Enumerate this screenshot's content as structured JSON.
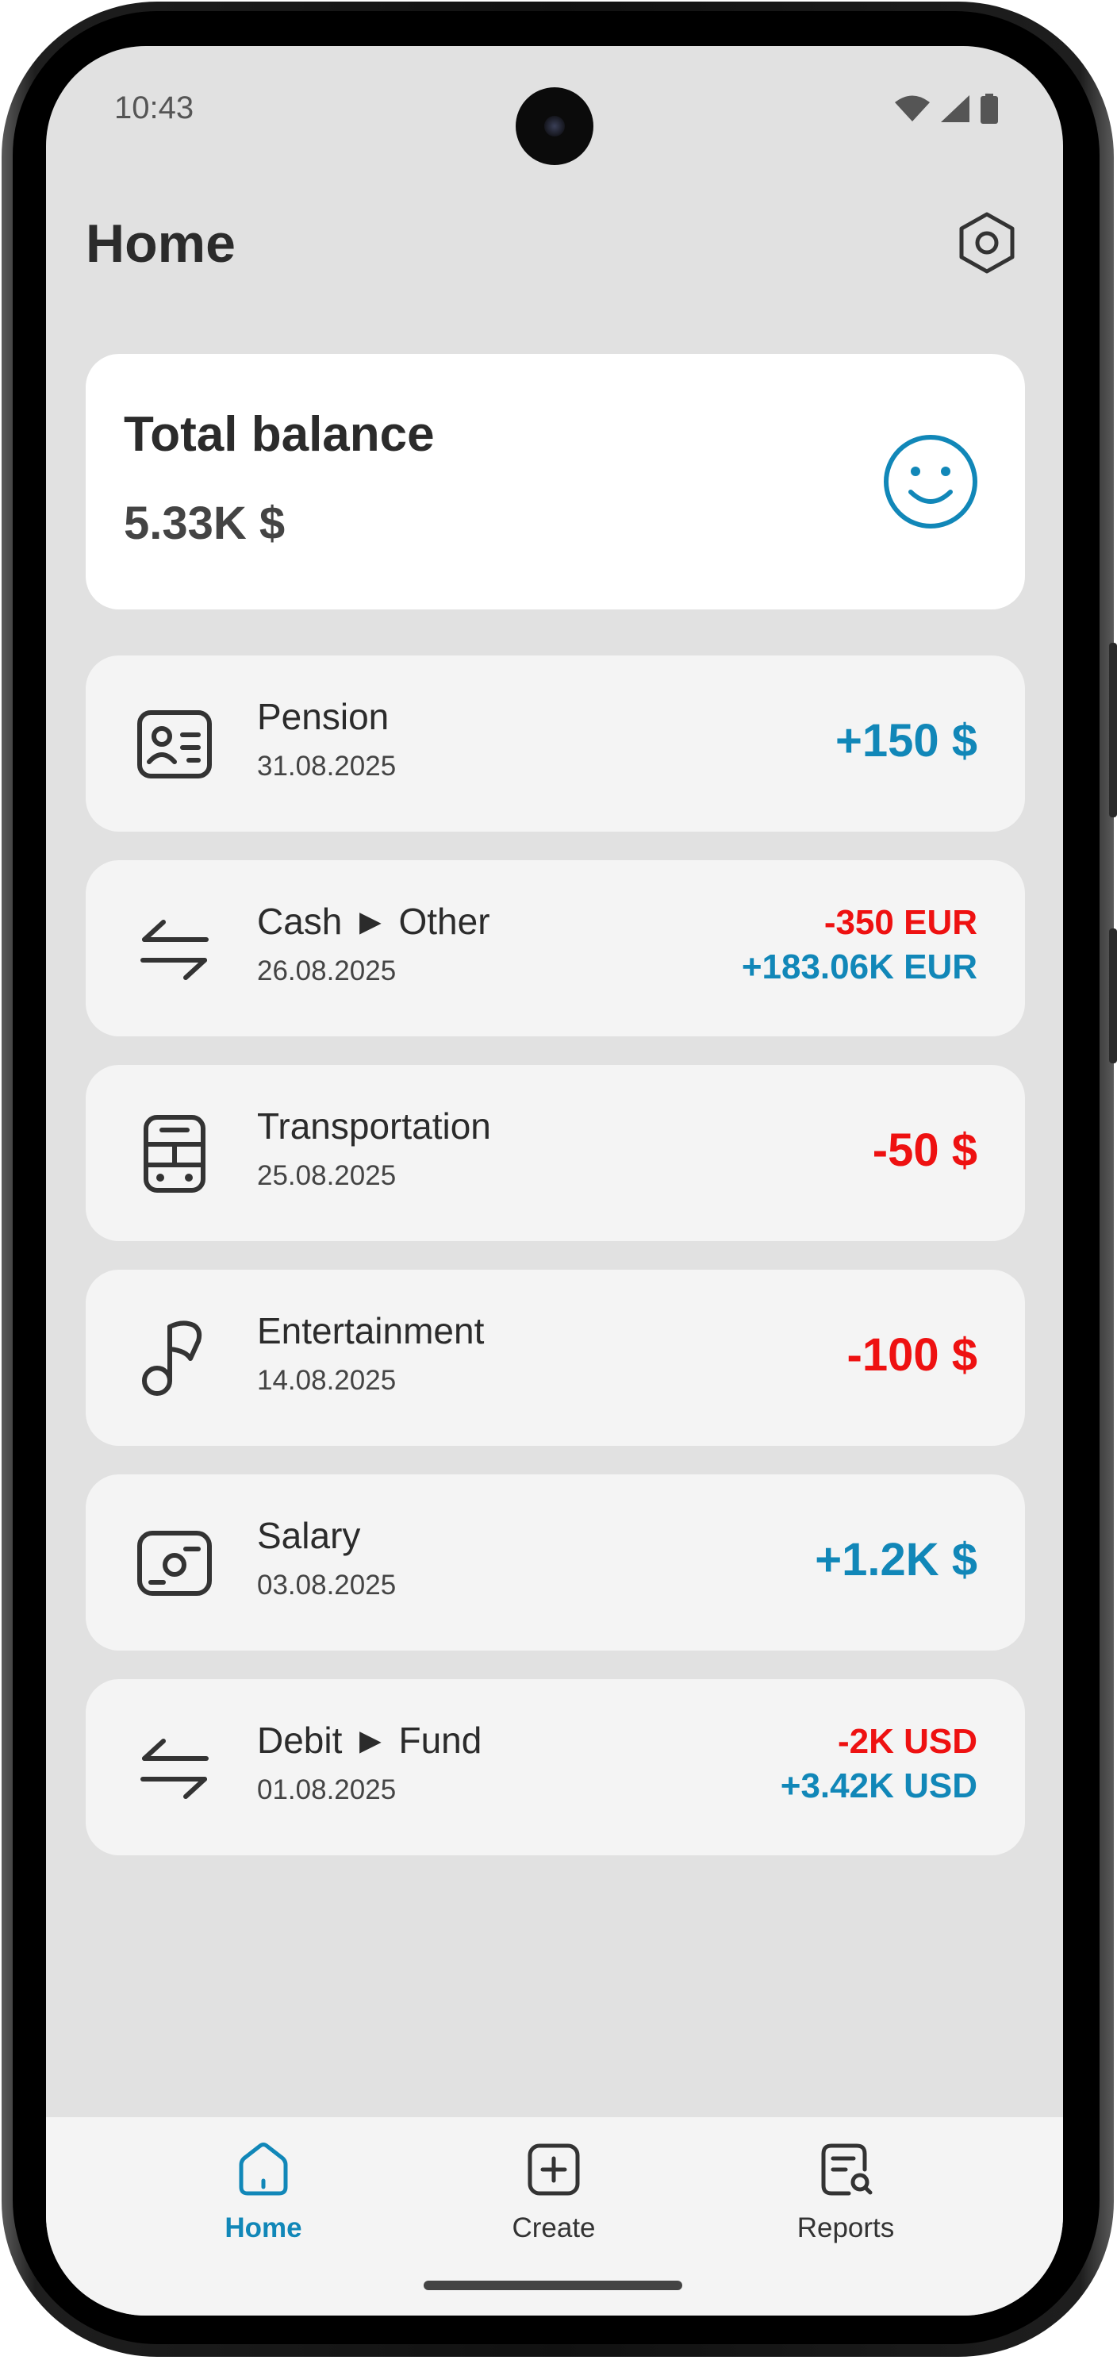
{
  "status_bar": {
    "time": "10:43",
    "icons": [
      "wifi-icon",
      "cellular-signal-icon",
      "battery-icon"
    ]
  },
  "header": {
    "title": "Home",
    "settings_icon": "settings-hexagon-icon"
  },
  "balance": {
    "title": "Total balance",
    "value": "5.33K $",
    "mood_icon": "smiley-face-icon"
  },
  "transactions": [
    {
      "icon": "id-card-icon",
      "title": "Pension",
      "date": "31.08.2025",
      "amount": "+150 $"
    },
    {
      "icon": "transfer-arrows-icon",
      "title": "Cash ► Other",
      "date": "26.08.2025",
      "amount_out": "-350 EUR",
      "amount_in": "+183.06K EUR"
    },
    {
      "icon": "bus-icon",
      "title": "Transportation",
      "date": "25.08.2025",
      "amount": "-50 $"
    },
    {
      "icon": "music-note-icon",
      "title": "Entertainment",
      "date": "14.08.2025",
      "amount": "-100 $"
    },
    {
      "icon": "wallet-icon",
      "title": "Salary",
      "date": "03.08.2025",
      "amount": "+1.2K $"
    },
    {
      "icon": "transfer-arrows-icon",
      "title": "Debit ► Fund",
      "date": "01.08.2025",
      "amount_out": "-2K USD",
      "amount_in": "+3.42K USD"
    }
  ],
  "bottom_nav": {
    "items": [
      {
        "label": "Home",
        "icon": "home-icon",
        "active": true
      },
      {
        "label": "Create",
        "icon": "add-square-icon",
        "active": false
      },
      {
        "label": "Reports",
        "icon": "report-search-icon",
        "active": false
      }
    ]
  },
  "colors": {
    "positive": "#1187b8",
    "negative": "#ee1111",
    "background": "#e1e1e1",
    "card": "#f4f4f4"
  }
}
